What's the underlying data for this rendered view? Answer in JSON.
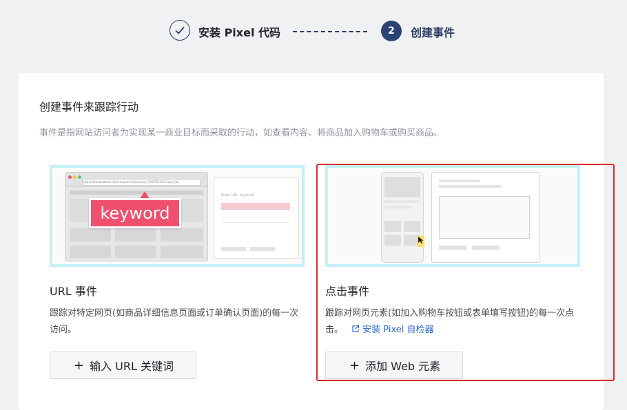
{
  "stepper": {
    "step1_label": "安装 Pixel 代码",
    "step2_number": "2",
    "step2_label": "创建事件"
  },
  "panel": {
    "title": "创建事件来跟踪行动",
    "description": "事件是指网站访问者为实现某一商业目标而采取的行动，如查看内容、将商品加入购物车或购买商品。"
  },
  "url_card": {
    "illustration": {
      "url_text": "http://adrocatadtext.com/shop/en-us/keyword_CELBT22201?color_tan",
      "keyword": "keyword",
      "form_label": "Enter URL keyword"
    },
    "title": "URL 事件",
    "description": "跟踪对特定网页(如商品详细信息页面或订单确认页面)的每一次访问。",
    "button_label": "输入 URL 关键词"
  },
  "click_card": {
    "title": "点击事件",
    "description": "跟踪对网页元素(如加入购物车按钮或表单填写按钮)的每一次点击。",
    "link_label": "安装 Pixel 自检器",
    "button_label": "添加 Web 元素"
  },
  "colors": {
    "accent": "#2b4374",
    "link": "#2f6bd9",
    "highlight": "#e0282b",
    "keyword_bg": "#f0506e"
  }
}
